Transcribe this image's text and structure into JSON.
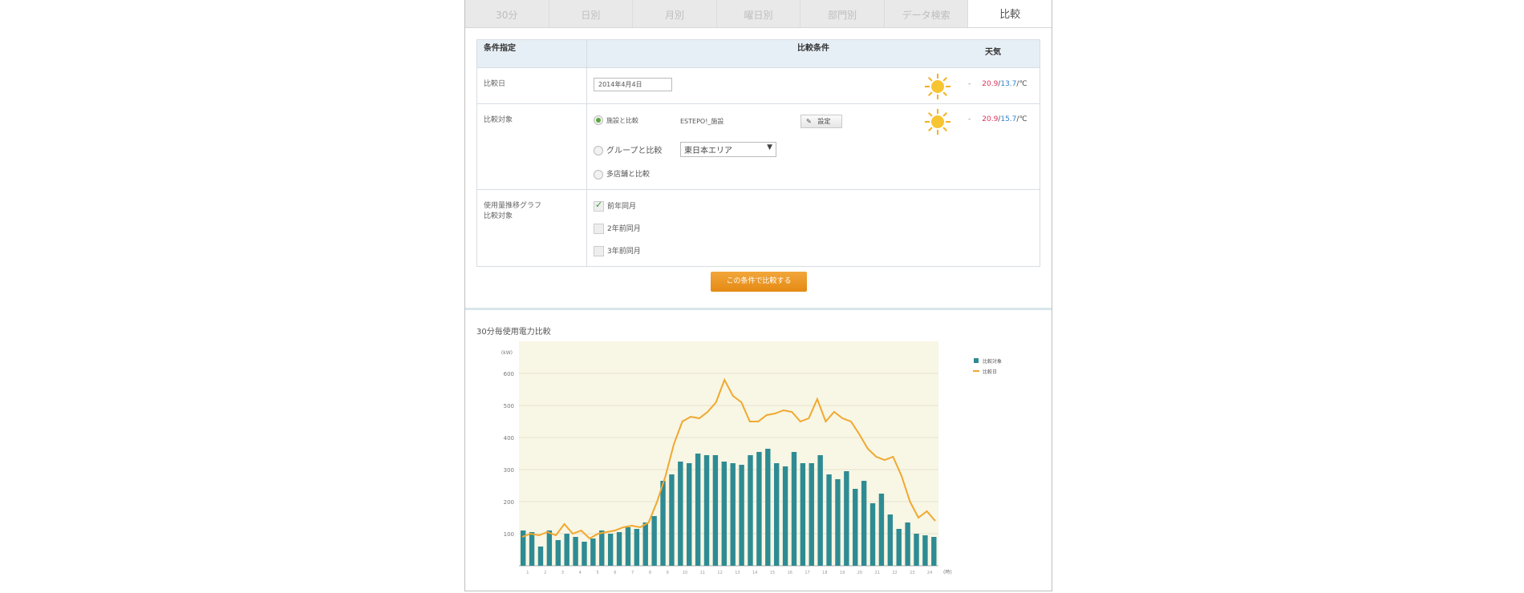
{
  "tabs": [
    "30分",
    "日別",
    "月別",
    "曜日別",
    "部門別",
    "データ検索",
    "比較"
  ],
  "active_tab": "比較",
  "condition_table": {
    "headers": [
      "条件指定",
      "比較条件",
      "天気"
    ],
    "date_row": {
      "label": "比較日",
      "date_value": "2014年4月4日",
      "weather_icon": "sun-icon",
      "temp_dash": "-",
      "temp_high": "20.9",
      "temp_low": "13.7",
      "temp_unit": "℃"
    },
    "target_row": {
      "label": "比較対象",
      "option_site": "施設と比較",
      "site_name": "ESTEPO!_施設",
      "set_button": "設定",
      "option_group": "グループと比較",
      "group_select": "東日本エリア",
      "option_multi": "多店舗と比較",
      "weather_icon": "sun-icon",
      "temp_dash": "-",
      "temp_high": "20.9",
      "temp_low": "15.7",
      "temp_unit": "℃"
    },
    "graph_row": {
      "label_line1": "使用量推移グラフ",
      "label_line2": "比較対象",
      "check_1": "前年同月",
      "check_2": "2年前同月",
      "check_3": "3年前同月"
    }
  },
  "compare_button": "この条件で比較する",
  "chart_section_title": "30分毎使用電力比較",
  "colors": {
    "bar": "#2e8b93",
    "line": "#f0a830",
    "plot_bg": "#f8f6e4",
    "accent_button": "#e98f1c"
  },
  "chart_data": {
    "type": "bar",
    "ylabel": "(kW)",
    "ylim": [
      0,
      700
    ],
    "yticks": [
      100,
      200,
      300,
      400,
      500,
      600
    ],
    "x_unit": "(時)",
    "x_ticks": [
      "1",
      "2",
      "3",
      "4",
      "5",
      "6",
      "7",
      "8",
      "9",
      "10",
      "11",
      "12",
      "13",
      "14",
      "15",
      "16",
      "17",
      "18",
      "19",
      "20",
      "21",
      "22",
      "23",
      "24"
    ],
    "legend_position": "right",
    "series": [
      {
        "name": "比較対象",
        "style": "bar",
        "values": [
          110,
          105,
          60,
          110,
          80,
          100,
          90,
          75,
          85,
          110,
          100,
          105,
          120,
          115,
          135,
          155,
          265,
          285,
          325,
          320,
          350,
          345,
          345,
          325,
          320,
          315,
          345,
          355,
          365,
          320,
          310,
          355,
          320,
          320,
          345,
          285,
          270,
          295,
          240,
          265,
          195,
          225,
          160,
          115,
          135,
          100,
          95,
          90
        ]
      },
      {
        "name": "比較日",
        "style": "line",
        "values": [
          90,
          100,
          95,
          105,
          95,
          130,
          100,
          110,
          85,
          100,
          105,
          110,
          120,
          125,
          120,
          135,
          200,
          280,
          380,
          450,
          465,
          460,
          480,
          510,
          580,
          530,
          510,
          450,
          450,
          470,
          475,
          485,
          480,
          450,
          460,
          520,
          450,
          480,
          460,
          450,
          410,
          365,
          340,
          330,
          340,
          280,
          200,
          150,
          170,
          140
        ]
      }
    ]
  }
}
